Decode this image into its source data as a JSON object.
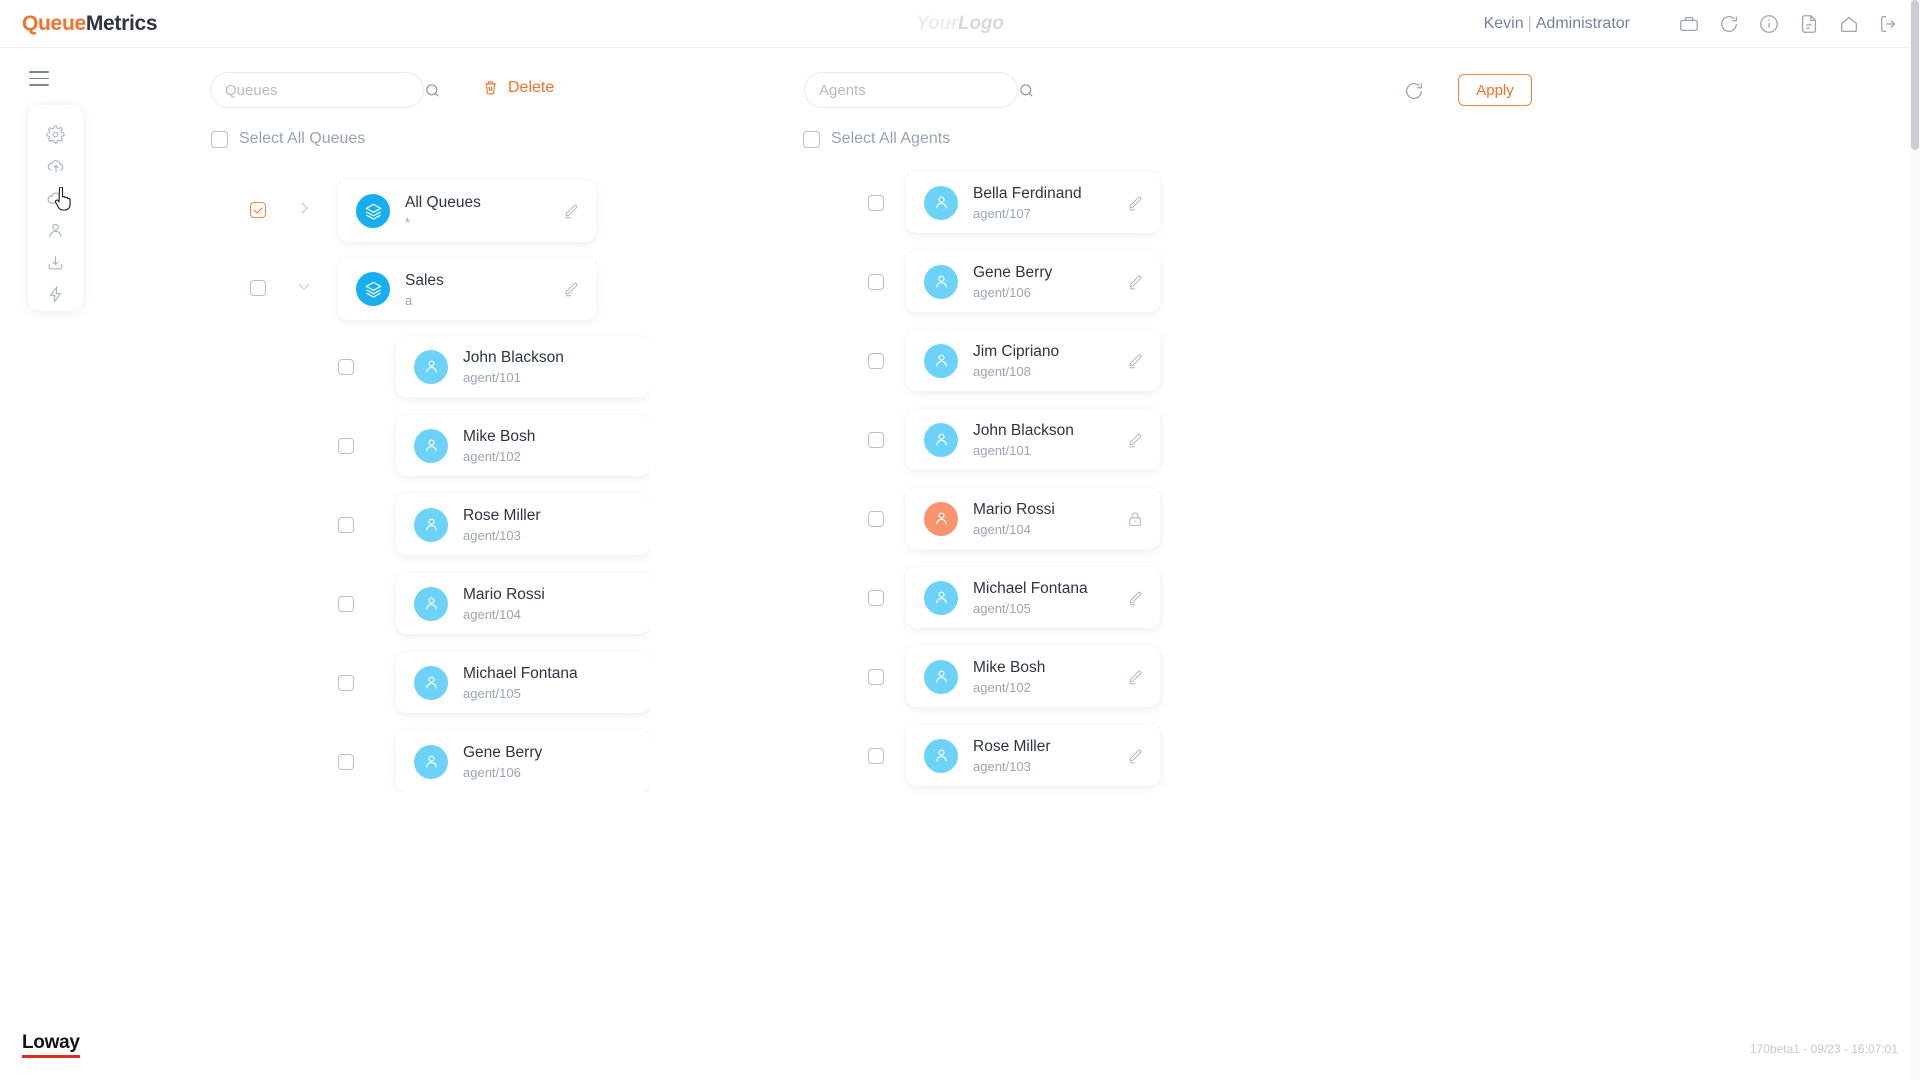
{
  "header": {
    "brand_primary": "Queue",
    "brand_secondary": "Metrics",
    "logo_first": "Your",
    "logo_second": "Logo",
    "user_name": "Kevin",
    "user_separator": "|",
    "user_role": "Administrator",
    "icons": [
      "briefcase-icon",
      "refresh-icon",
      "info-icon",
      "document-icon",
      "home-icon",
      "logout-icon"
    ]
  },
  "sidebar": {
    "menu_toggle": "hamburger-icon",
    "items": [
      {
        "name": "settings",
        "icon": "gear-icon"
      },
      {
        "name": "cloud-upload",
        "icon": "cloud-upload-icon"
      },
      {
        "name": "cloud",
        "icon": "cloud-icon"
      },
      {
        "name": "user",
        "icon": "user-icon"
      },
      {
        "name": "download",
        "icon": "download-box-icon"
      },
      {
        "name": "realtime",
        "icon": "lightning-icon"
      }
    ]
  },
  "toolbar": {
    "queues_search_placeholder": "Queues",
    "queues_search_value": "",
    "agents_search_placeholder": "Agents",
    "agents_search_value": "",
    "delete_label": "Delete",
    "apply_label": "Apply",
    "refresh_icon": "refresh-icon"
  },
  "queues_panel": {
    "select_all_label": "Select All Queues",
    "select_all_checked": false,
    "rows": [
      {
        "type": "queue",
        "title": "All Queues",
        "subtitle": "*",
        "checked": true,
        "expanded": false,
        "action_icon": "pencil-icon"
      },
      {
        "type": "queue",
        "title": "Sales",
        "subtitle": "a",
        "checked": false,
        "expanded": true,
        "action_icon": "pencil-icon"
      },
      {
        "type": "agent",
        "title": "John Blackson",
        "subtitle": "agent/101",
        "checked": false
      },
      {
        "type": "agent",
        "title": "Mike Bosh",
        "subtitle": "agent/102",
        "checked": false
      },
      {
        "type": "agent",
        "title": "Rose Miller",
        "subtitle": "agent/103",
        "checked": false
      },
      {
        "type": "agent",
        "title": "Mario Rossi",
        "subtitle": "agent/104",
        "checked": false
      },
      {
        "type": "agent",
        "title": "Michael Fontana",
        "subtitle": "agent/105",
        "checked": false
      },
      {
        "type": "agent",
        "title": "Gene Berry",
        "subtitle": "agent/106",
        "checked": false
      }
    ]
  },
  "agents_panel": {
    "select_all_label": "Select All Agents",
    "select_all_checked": false,
    "rows": [
      {
        "title": "Bella Ferdinand",
        "subtitle": "agent/107",
        "checked": false,
        "action_icon": "pencil-icon",
        "locked": false
      },
      {
        "title": "Gene Berry",
        "subtitle": "agent/106",
        "checked": false,
        "action_icon": "pencil-icon",
        "locked": false
      },
      {
        "title": "Jim Cipriano",
        "subtitle": "agent/108",
        "checked": false,
        "action_icon": "pencil-icon",
        "locked": false
      },
      {
        "title": "John Blackson",
        "subtitle": "agent/101",
        "checked": false,
        "action_icon": "pencil-icon",
        "locked": false
      },
      {
        "title": "Mario Rossi",
        "subtitle": "agent/104",
        "checked": false,
        "action_icon": "lock-icon",
        "locked": true
      },
      {
        "title": "Michael Fontana",
        "subtitle": "agent/105",
        "checked": false,
        "action_icon": "pencil-icon",
        "locked": false
      },
      {
        "title": "Mike Bosh",
        "subtitle": "agent/102",
        "checked": false,
        "action_icon": "pencil-icon",
        "locked": false
      },
      {
        "title": "Rose Miller",
        "subtitle": "agent/103",
        "checked": false,
        "action_icon": "pencil-icon",
        "locked": false
      }
    ]
  },
  "footer": {
    "company": "Loway",
    "build_info": "170beta1 - 09/23 - 16:07:01"
  },
  "colors": {
    "accent_orange": "#f4712a",
    "queue_blue": "#17aeef",
    "agent_blue": "#6dd2f7",
    "locked_orange": "#f9936e",
    "text_dark": "#2c3542",
    "text_muted": "#9aa5b1"
  }
}
